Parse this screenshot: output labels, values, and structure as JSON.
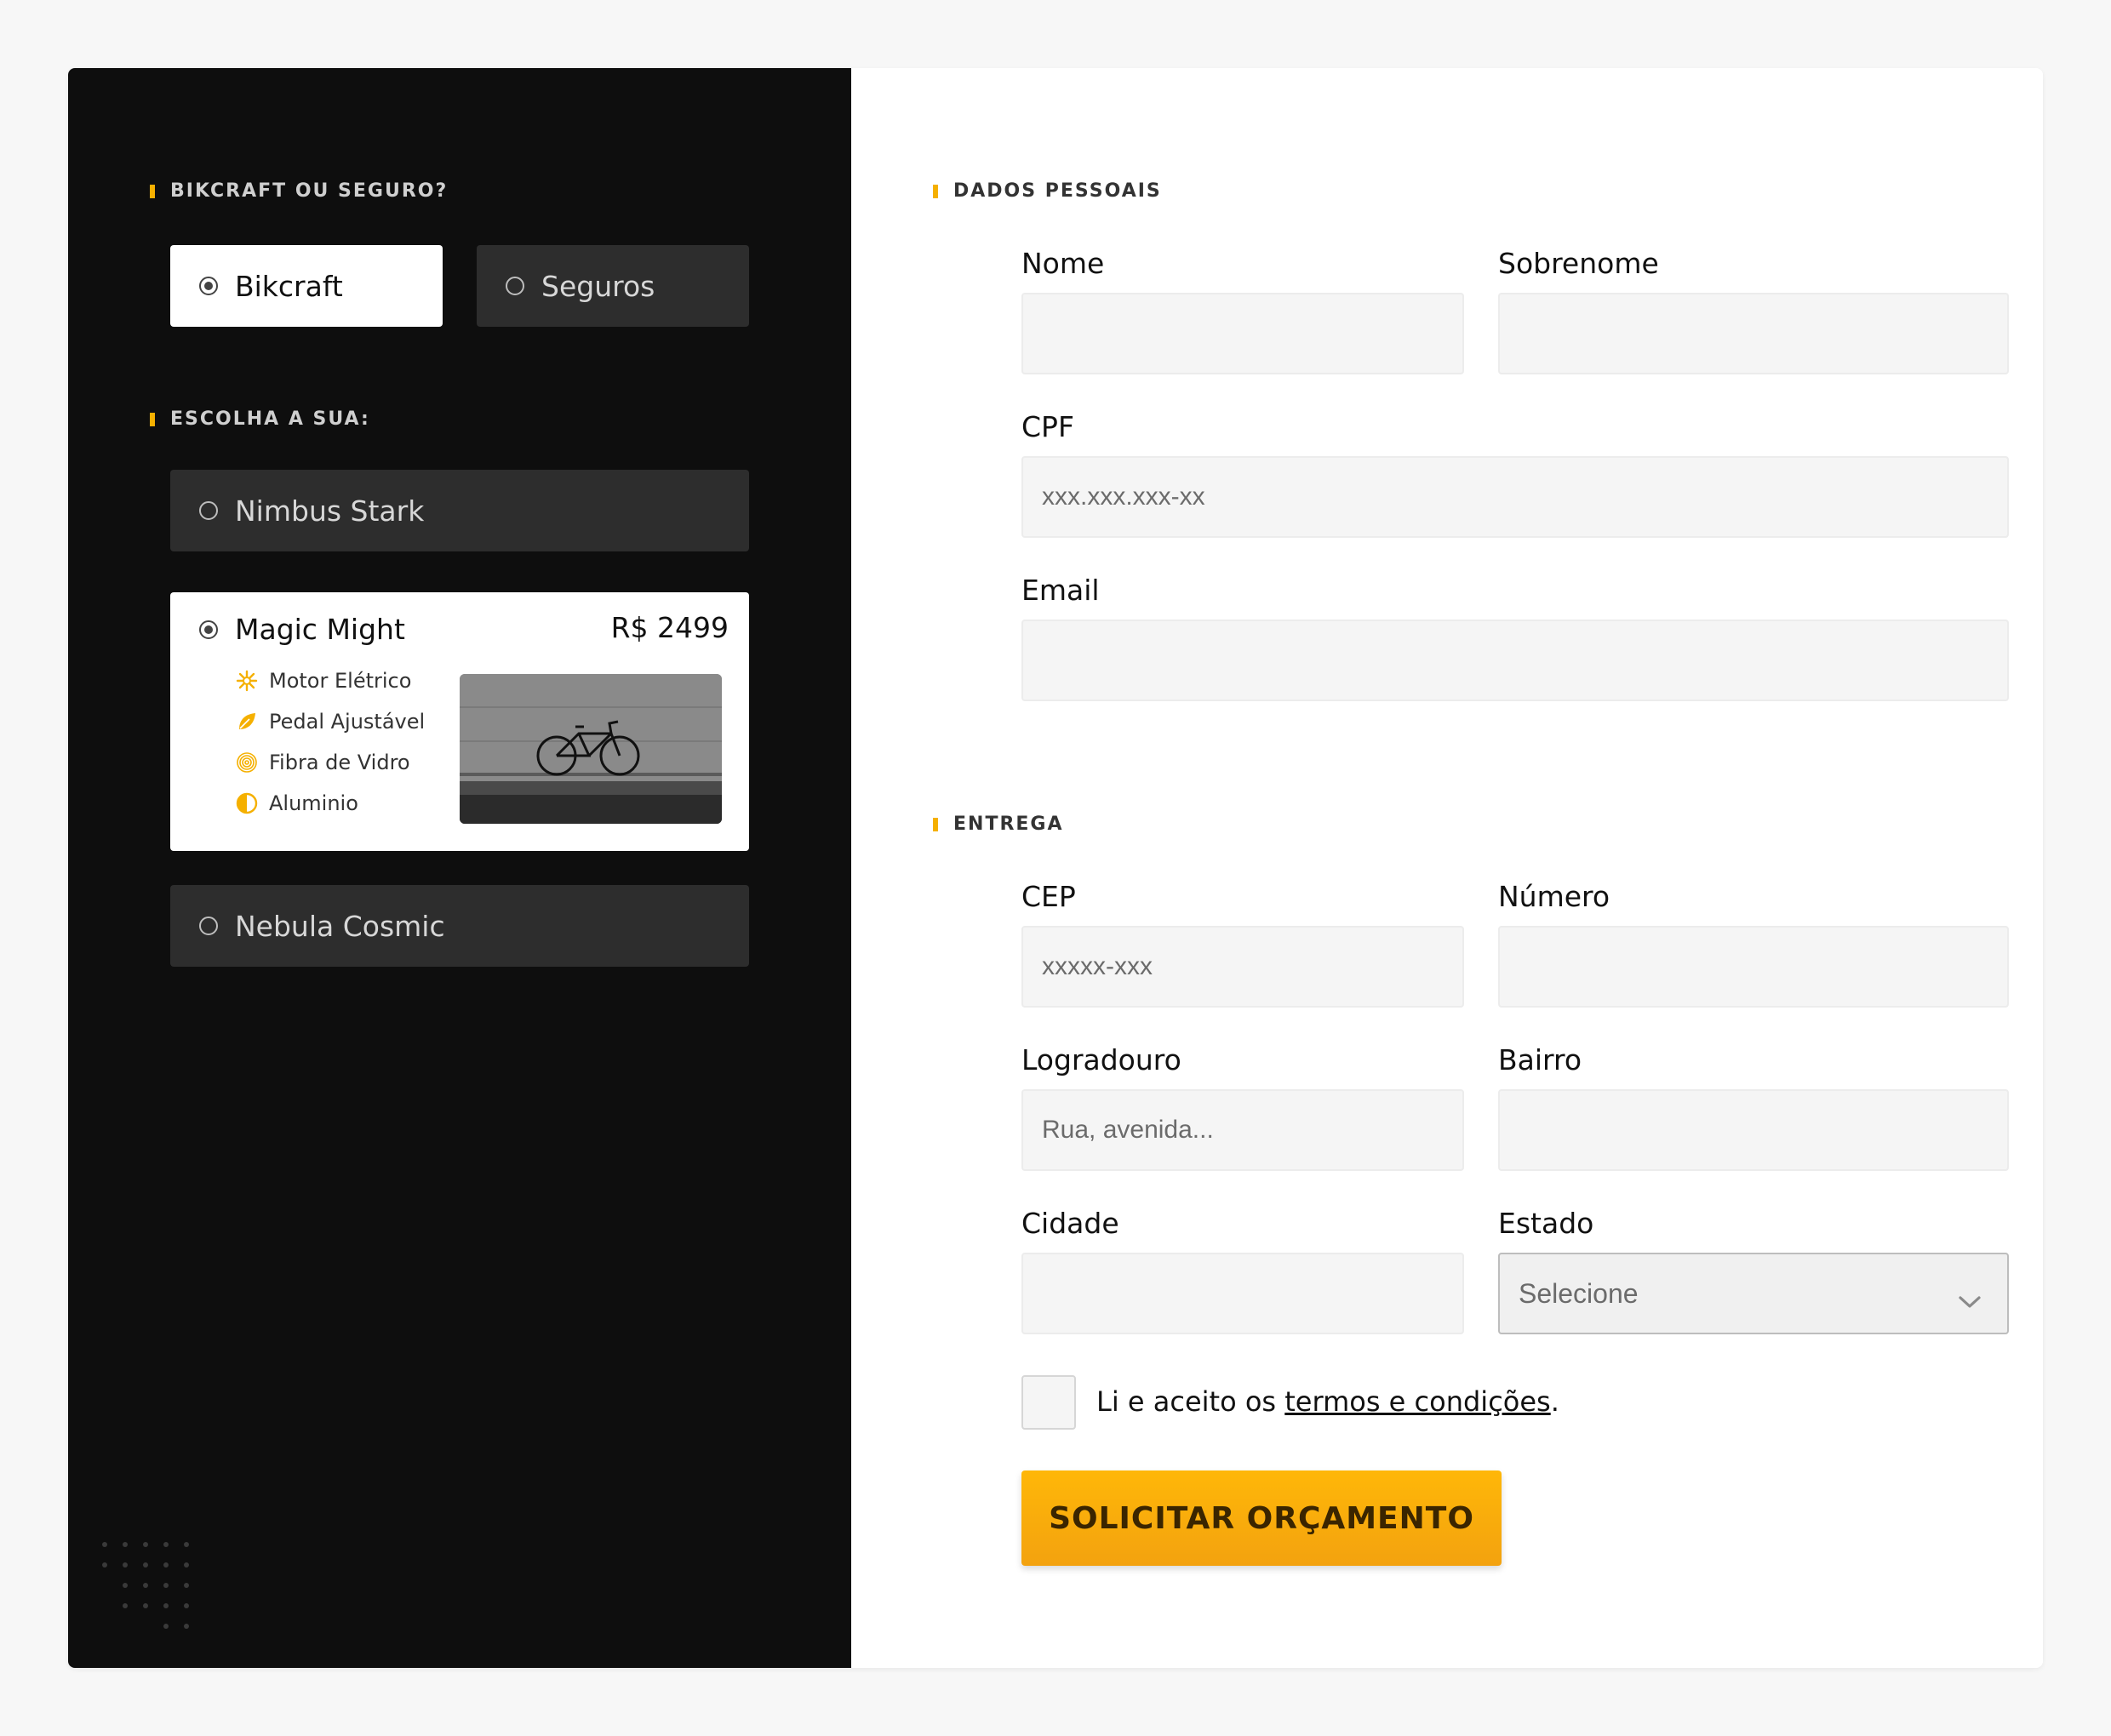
{
  "left": {
    "section_type": "BIKCRAFT OU SEGURO?",
    "type_options": [
      {
        "label": "Bikcraft",
        "selected": true
      },
      {
        "label": "Seguros",
        "selected": false
      }
    ],
    "section_choose": "ESCOLHA A SUA:",
    "products": [
      {
        "label": "Nimbus Stark",
        "selected": false
      },
      {
        "label": "Magic Might",
        "selected": true,
        "price": "R$ 2499",
        "features": [
          "Motor Elétrico",
          "Pedal Ajustável",
          "Fibra de Vidro",
          "Aluminio"
        ]
      },
      {
        "label": "Nebula Cosmic",
        "selected": false
      }
    ]
  },
  "form": {
    "section_personal": "DADOS PESSOAIS",
    "nome_label": "Nome",
    "sobrenome_label": "Sobrenome",
    "cpf_label": "CPF",
    "cpf_placeholder": "xxx.xxx.xxx-xx",
    "email_label": "Email",
    "section_delivery": "ENTREGA",
    "cep_label": "CEP",
    "cep_placeholder": "xxxxx-xxx",
    "numero_label": "Número",
    "logradouro_label": "Logradouro",
    "logradouro_placeholder": "Rua, avenida...",
    "bairro_label": "Bairro",
    "cidade_label": "Cidade",
    "estado_label": "Estado",
    "estado_value": "Selecione",
    "terms_prefix": "Li e aceito os ",
    "terms_link": "termos e condições",
    "terms_suffix": ".",
    "submit_label": "SOLICITAR ORÇAMENTO"
  },
  "colors": {
    "accent": "#f5b000",
    "dark_panel": "#0e0e0e",
    "dark_option": "#2d2d2d"
  },
  "icons": [
    "motor-icon",
    "leaf-icon",
    "fingerprint-icon",
    "half-circle-icon",
    "chevron-down-icon"
  ]
}
